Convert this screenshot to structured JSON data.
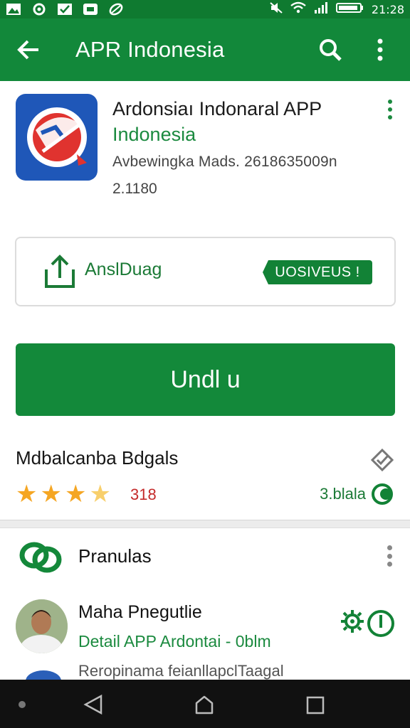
{
  "status_bar": {
    "time": "21:28",
    "left_icons": [
      "photo-icon",
      "settings-notification-icon",
      "check-icon",
      "message-icon",
      "leaf-icon"
    ],
    "right_icons": [
      "mute-icon",
      "wifi-icon",
      "signal-icon",
      "battery-icon"
    ]
  },
  "app_bar": {
    "title": "APR Indonesia",
    "back_icon": "arrow-left-icon",
    "search_icon": "search-icon",
    "more_icon": "more-vert-icon"
  },
  "app_info": {
    "name": "Ardonsiaı Indonaral APP",
    "developer": "Indonesia",
    "meta_line1": "Avbewingka Mads. 2618635009n",
    "meta_line2": "2.1180"
  },
  "share_section": {
    "label": "AnslDuag",
    "tag_label": "UOSIVEUS !"
  },
  "install_button": {
    "label": "Undl u"
  },
  "rating": {
    "title": "Mdbalcanba Bdgals",
    "stars": 3.5,
    "count": "318",
    "right_label": "3.blala"
  },
  "section2": {
    "title": "Pranulas",
    "item": {
      "name": "Maha Pnegutlie",
      "subtitle": "Detail APP Ardontai - 0blm",
      "description": "Reropinama feianllapclTaagal"
    }
  },
  "nav_bar": {
    "icons": [
      "back-triangle-icon",
      "home-icon",
      "recent-apps-icon"
    ]
  },
  "colors": {
    "primary": "#12883a",
    "status_bar": "#0f7a30",
    "star": "#f5a623",
    "rating_count": "#c42a2a",
    "app_icon_bg": "#1f57b8"
  }
}
